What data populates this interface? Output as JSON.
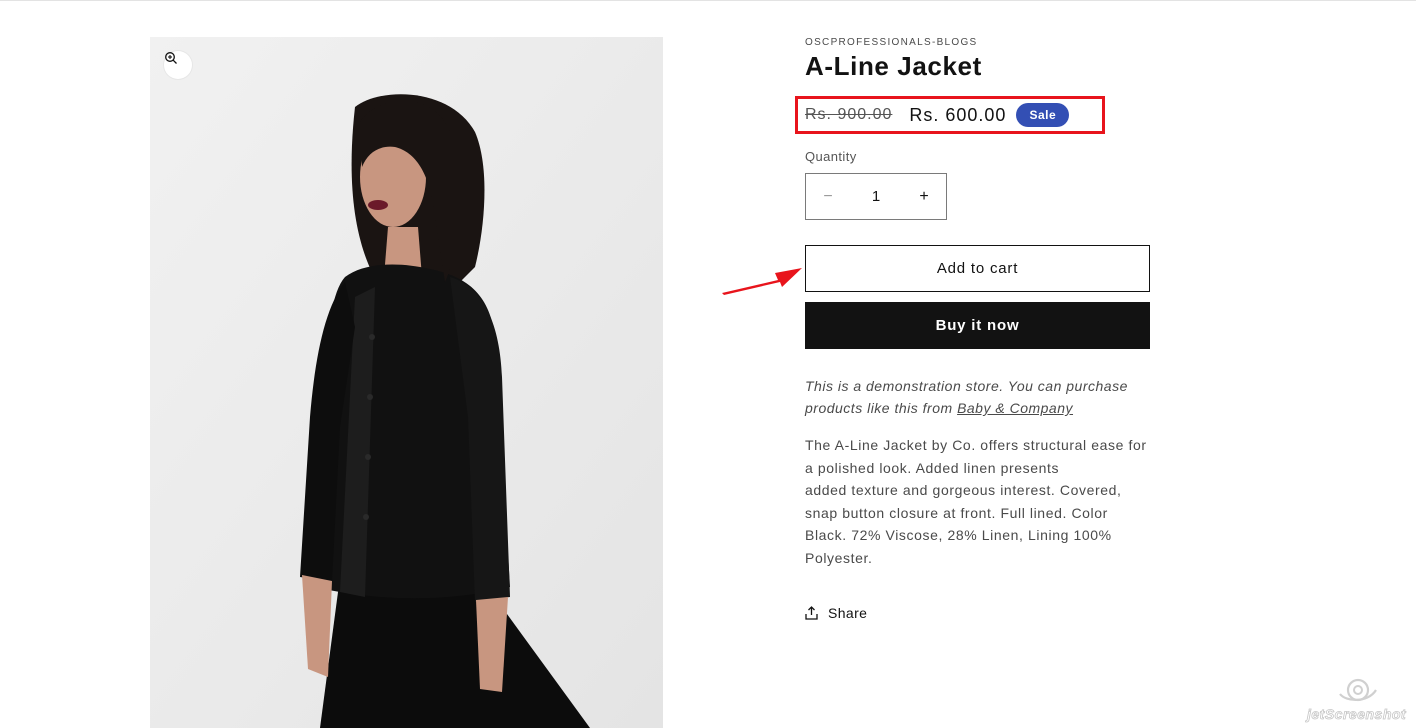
{
  "product": {
    "vendor": "OSCPROFESSIONALS-BLOGS",
    "title": "A-Line Jacket",
    "price_regular": "Rs. 900.00",
    "price_sale": "Rs. 600.00",
    "badge": "Sale",
    "image_alt": "Woman wearing a black A-Line jacket"
  },
  "quantity": {
    "label": "Quantity",
    "value": "1",
    "decrease_symbol": "−",
    "increase_symbol": "+"
  },
  "actions": {
    "add_to_cart": "Add to cart",
    "buy_now": "Buy it now",
    "share": "Share"
  },
  "demo_note": {
    "text": "This is a demonstration store. You can purchase products like this from ",
    "link_text": "Baby & Company"
  },
  "description_lines": [
    "The A-Line Jacket by Co. offers structural ease for",
    "a polished look. Added linen presents",
    "added texture and gorgeous interest. Covered,",
    "snap button closure at front. Full lined. Color",
    "Black. 72% Viscose, 28% Linen, Lining 100%",
    "Polyester."
  ],
  "icons": {
    "zoom": "zoom-in-icon",
    "share": "share-icon",
    "annotation_arrow": "arrow-icon",
    "watermark": "jetscreenshot-logo"
  },
  "watermark": {
    "text": "jetScreenshot"
  },
  "colors": {
    "badge_bg": "#334fb4",
    "buy_button_bg": "#121212",
    "annotation_red": "#e8141c"
  }
}
